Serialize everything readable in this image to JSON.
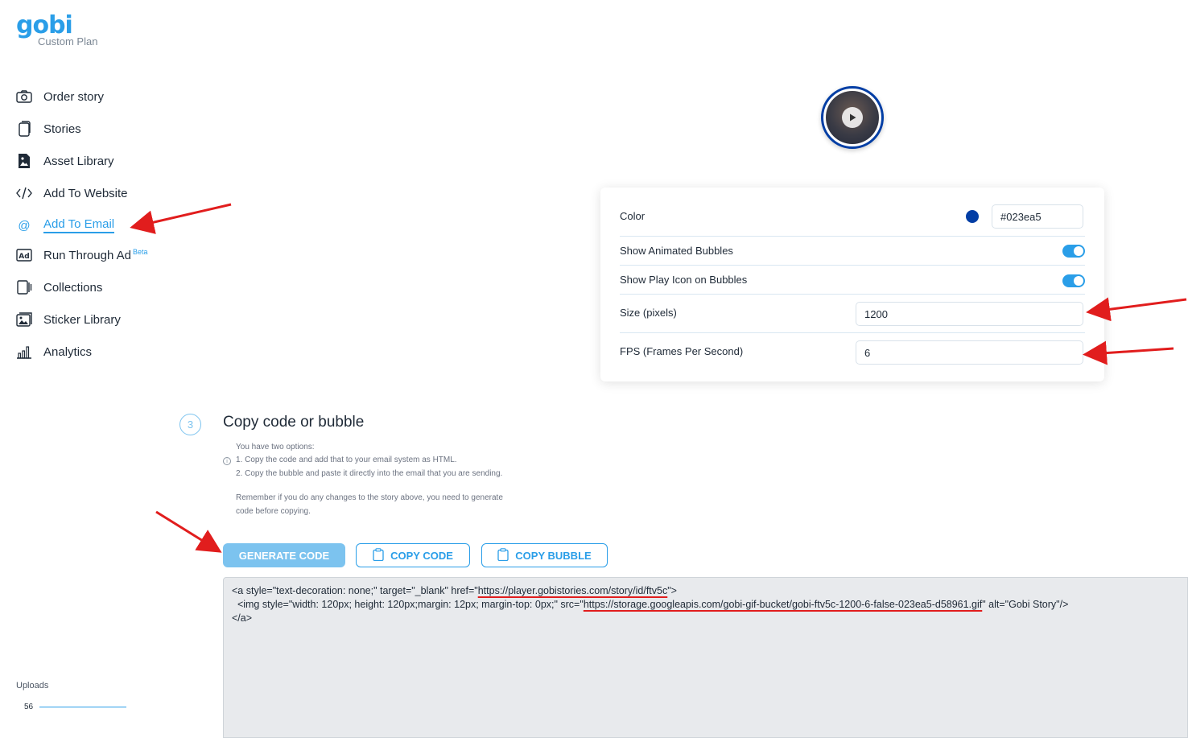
{
  "brand": {
    "logo": "gobi",
    "plan": "Custom Plan",
    "accent": "#2a9ee8"
  },
  "sidebar": {
    "items": [
      {
        "label": "Order story",
        "icon": "camera-icon",
        "active": false
      },
      {
        "label": "Stories",
        "icon": "stories-icon",
        "active": false
      },
      {
        "label": "Asset Library",
        "icon": "image-file-icon",
        "active": false
      },
      {
        "label": "Add To Website",
        "icon": "code-icon",
        "active": false
      },
      {
        "label": "Add To Email",
        "icon": "at-icon",
        "active": true
      },
      {
        "label": "Run Through Ad",
        "badge": "Beta",
        "icon": "ad-icon",
        "active": false
      },
      {
        "label": "Collections",
        "icon": "collections-icon",
        "active": false
      },
      {
        "label": "Sticker Library",
        "icon": "sticker-icon",
        "active": false
      },
      {
        "label": "Analytics",
        "icon": "analytics-icon",
        "active": false
      }
    ],
    "uploads": {
      "label": "Uploads",
      "count": "56"
    }
  },
  "preview": {
    "bubble_color": "#023ea5",
    "icon": "play-icon"
  },
  "settings": {
    "color": {
      "label": "Color",
      "value": "#023ea5"
    },
    "animated_bubbles": {
      "label": "Show Animated Bubbles",
      "on": true
    },
    "play_icon": {
      "label": "Show Play Icon on Bubbles",
      "on": true
    },
    "size": {
      "label": "Size (pixels)",
      "value": "1200"
    },
    "fps": {
      "label": "FPS (Frames Per Second)",
      "value": "6"
    }
  },
  "step": {
    "number": "3",
    "title": "Copy code or bubble",
    "help_lines": [
      "You have two options:",
      "1. Copy the code and add that to your email system as HTML.",
      "2. Copy the bubble and paste it directly into the email that you are sending.",
      "Remember if you do any changes to the story above, you need to generate",
      "code before copying."
    ]
  },
  "buttons": {
    "generate": "GENERATE CODE",
    "copy_code": "COPY CODE",
    "copy_bubble": "COPY BUBBLE"
  },
  "code": {
    "line1_pre": "<a style=\"text-decoration: none;\" target=\"_blank\" href=\"",
    "line1_url": "https://player.gobistories.com/story/id/ftv5c",
    "line1_post": "\">",
    "line2_pre": "  <img style=\"width: 120px; height: 120px;margin: 12px; margin-top: 0px;\" src=\"",
    "line2_url": "https://storage.googleapis.com/gobi-gif-bucket/gobi-ftv5c-1200-6-false-023ea5-d58961.gif",
    "line2_post": "\" alt=\"Gobi Story\"/>",
    "line3": "</a>"
  }
}
